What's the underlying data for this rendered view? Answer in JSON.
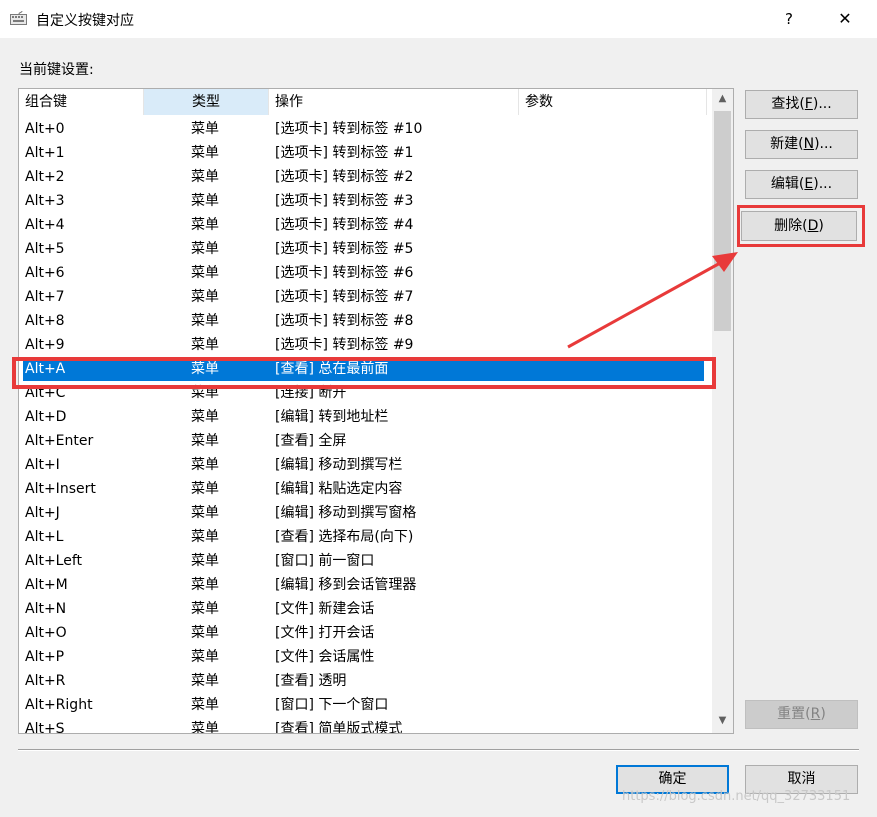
{
  "window": {
    "title": "自定义按键对应",
    "help_label": "?",
    "close_label": "✕"
  },
  "icons": {
    "app": "keyboard-icon"
  },
  "list_label": "当前键设置:",
  "columns": [
    "组合键",
    "类型",
    "操作",
    "参数"
  ],
  "rows": [
    [
      "Alt+0",
      "菜单",
      "[选项卡] 转到标签 #10",
      ""
    ],
    [
      "Alt+1",
      "菜单",
      "[选项卡] 转到标签 #1",
      ""
    ],
    [
      "Alt+2",
      "菜单",
      "[选项卡] 转到标签 #2",
      ""
    ],
    [
      "Alt+3",
      "菜单",
      "[选项卡] 转到标签 #3",
      ""
    ],
    [
      "Alt+4",
      "菜单",
      "[选项卡] 转到标签 #4",
      ""
    ],
    [
      "Alt+5",
      "菜单",
      "[选项卡] 转到标签 #5",
      ""
    ],
    [
      "Alt+6",
      "菜单",
      "[选项卡] 转到标签 #6",
      ""
    ],
    [
      "Alt+7",
      "菜单",
      "[选项卡] 转到标签 #7",
      ""
    ],
    [
      "Alt+8",
      "菜单",
      "[选项卡] 转到标签 #8",
      ""
    ],
    [
      "Alt+9",
      "菜单",
      "[选项卡] 转到标签 #9",
      ""
    ],
    [
      "Alt+A",
      "菜单",
      "[查看] 总在最前面",
      ""
    ],
    [
      "Alt+C",
      "菜单",
      "[连接] 断开",
      ""
    ],
    [
      "Alt+D",
      "菜单",
      "[编辑] 转到地址栏",
      ""
    ],
    [
      "Alt+Enter",
      "菜单",
      "[查看] 全屏",
      ""
    ],
    [
      "Alt+I",
      "菜单",
      "[编辑] 移动到撰写栏",
      ""
    ],
    [
      "Alt+Insert",
      "菜单",
      "[编辑] 粘贴选定内容",
      ""
    ],
    [
      "Alt+J",
      "菜单",
      "[编辑] 移动到撰写窗格",
      ""
    ],
    [
      "Alt+L",
      "菜单",
      "[查看] 选择布局(向下)",
      ""
    ],
    [
      "Alt+Left",
      "菜单",
      "[窗口] 前一窗口",
      ""
    ],
    [
      "Alt+M",
      "菜单",
      "[编辑] 移到会话管理器",
      ""
    ],
    [
      "Alt+N",
      "菜单",
      "[文件] 新建会话",
      ""
    ],
    [
      "Alt+O",
      "菜单",
      "[文件] 打开会话",
      ""
    ],
    [
      "Alt+P",
      "菜单",
      "[文件] 会话属性",
      ""
    ],
    [
      "Alt+R",
      "菜单",
      "[查看] 透明",
      ""
    ],
    [
      "Alt+Right",
      "菜单",
      "[窗口] 下一个窗口",
      ""
    ],
    [
      "Alt+S",
      "菜单",
      "[查看] 简单版式模式",
      ""
    ]
  ],
  "selected_row": 10,
  "buttons": {
    "find": {
      "text": "查找(",
      "key": "F",
      "tail": ")..."
    },
    "new": {
      "text": "新建(",
      "key": "N",
      "tail": ")..."
    },
    "edit": {
      "text": "编辑(",
      "key": "E",
      "tail": ")..."
    },
    "delete": {
      "text": "删除(",
      "key": "D",
      "tail": ")"
    },
    "reset": {
      "text": "重置(",
      "key": "R",
      "tail": ")"
    },
    "ok": "确定",
    "cancel": "取消"
  },
  "watermark": "https://blog.csdn.net/qq_32733151",
  "colors": {
    "selection": "#0078d7",
    "annotation": "#e83a3a"
  }
}
